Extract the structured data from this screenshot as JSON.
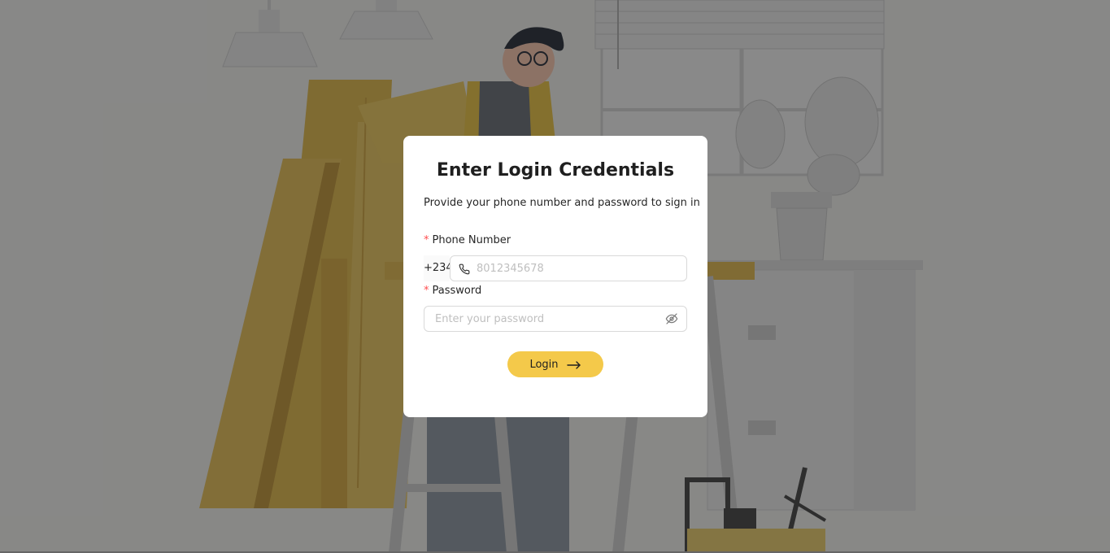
{
  "modal": {
    "title": "Enter Login Credentials",
    "subtitle": "Provide your phone number and password to sign in"
  },
  "form": {
    "required_mark": "*",
    "phone": {
      "label": "Phone Number",
      "prefix": "+234",
      "value": "",
      "placeholder": "8012345678",
      "icon": "phone-icon"
    },
    "password": {
      "label": "Password",
      "value": "",
      "placeholder": "Enter your password",
      "icon": "eye-slash-icon"
    },
    "login_button": {
      "label": "Login",
      "icon": "arrow-right-icon"
    }
  },
  "colors": {
    "accent": "#f4c94a",
    "required": "#ff4d4f",
    "overlay": "rgba(0,0,0,0.45)"
  }
}
